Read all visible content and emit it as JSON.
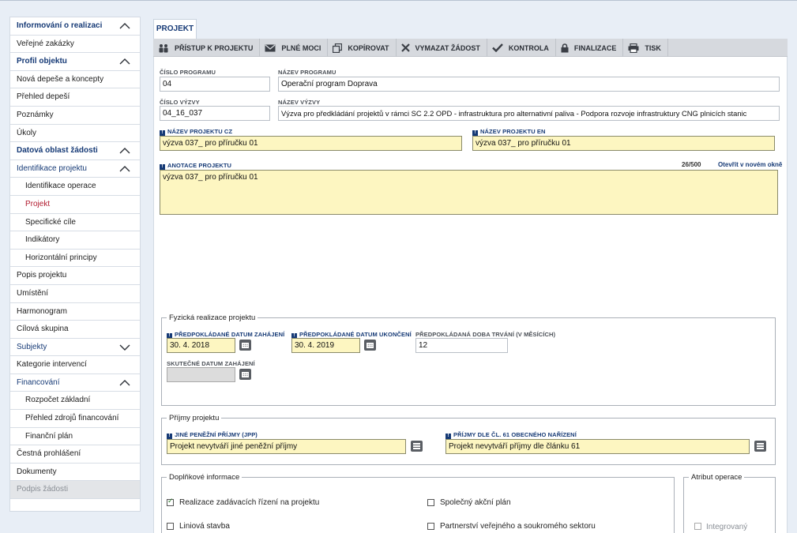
{
  "sidebar": {
    "items": [
      {
        "label": "Informování o realizaci",
        "kind": "section",
        "chevron": "up"
      },
      {
        "label": "Veřejné zakázky",
        "kind": "item"
      },
      {
        "label": "Profil objektu",
        "kind": "section",
        "chevron": "up"
      },
      {
        "label": "Nová depeše a koncepty",
        "kind": "item"
      },
      {
        "label": "Přehled depeší",
        "kind": "item"
      },
      {
        "label": "Poznámky",
        "kind": "item"
      },
      {
        "label": "Úkoly",
        "kind": "item"
      },
      {
        "label": "Datová oblast žádosti",
        "kind": "section",
        "chevron": "up"
      },
      {
        "label": "Identifikace projektu",
        "kind": "section-light",
        "chevron": "up"
      },
      {
        "label": "Identifikace operace",
        "kind": "sub"
      },
      {
        "label": "Projekt",
        "kind": "sub-active"
      },
      {
        "label": "Specifické cíle",
        "kind": "sub"
      },
      {
        "label": "Indikátory",
        "kind": "sub"
      },
      {
        "label": "Horizontální principy",
        "kind": "sub"
      },
      {
        "label": "Popis projektu",
        "kind": "item"
      },
      {
        "label": "Umístění",
        "kind": "item"
      },
      {
        "label": "Harmonogram",
        "kind": "item"
      },
      {
        "label": "Cílová skupina",
        "kind": "item"
      },
      {
        "label": "Subjekty",
        "kind": "section-light",
        "chevron": "down"
      },
      {
        "label": "Kategorie intervencí",
        "kind": "item"
      },
      {
        "label": "Financování",
        "kind": "section-light",
        "chevron": "up"
      },
      {
        "label": "Rozpočet základní",
        "kind": "sub"
      },
      {
        "label": "Přehled zdrojů financování",
        "kind": "sub"
      },
      {
        "label": "Finanční plán",
        "kind": "sub"
      },
      {
        "label": "Čestná prohlášení",
        "kind": "item"
      },
      {
        "label": "Dokumenty",
        "kind": "item"
      },
      {
        "label": "Podpis žádosti",
        "kind": "disabled"
      }
    ]
  },
  "tab": {
    "label": "PROJEKT"
  },
  "toolbar": {
    "access": "PŘÍSTUP K PROJEKTU",
    "powers": "PLNÉ MOCI",
    "copy": "KOPÍROVAT",
    "delete": "VYMAZAT ŽÁDOST",
    "check": "KONTROLA",
    "finalize": "FINALIZACE",
    "print": "TISK"
  },
  "form": {
    "program_number_label": "ČÍSLO PROGRAMU",
    "program_number": "04",
    "program_name_label": "NÁZEV PROGRAMU",
    "program_name": "Operační program Doprava",
    "call_number_label": "ČÍSLO VÝZVY",
    "call_number": "04_16_037",
    "call_name_label": "NÁZEV VÝZVY",
    "call_name": "Výzva pro předkládání projektů v rámci SC 2.2 OPD - infrastruktura pro alternativní paliva - Podpora rozvoje infrastruktury CNG plnicích stanic",
    "project_name_cz_label": "NÁZEV PROJEKTU CZ",
    "project_name_cz": "výzva 037_ pro příručku 01",
    "project_name_en_label": "NÁZEV PROJEKTU EN",
    "project_name_en": "výzva 037_ pro příručku 01",
    "annotation_label": "ANOTACE PROJEKTU",
    "annotation_counter": "26/500",
    "annotation_open_link": "Otevřít v novém okně",
    "annotation": "výzva 037_ pro příručku 01"
  },
  "physical": {
    "legend": "Fyzická realizace projektu",
    "start_label": "PŘEDPOKLÁDANÉ DATUM ZAHÁJENÍ",
    "start": "30. 4. 2018",
    "end_label": "PŘEDPOKLÁDANÉ DATUM UKONČENÍ",
    "end": "30. 4. 2019",
    "duration_label": "PŘEDPOKLÁDANÁ DOBA TRVÁNÍ (V MĚSÍCÍCH)",
    "duration": "12",
    "actual_start_label": "SKUTEČNÉ DATUM ZAHÁJENÍ",
    "actual_start": ""
  },
  "income": {
    "legend": "Příjmy projektu",
    "other_label": "JINÉ PENĚŽNÍ PŘÍJMY (JPP)",
    "other": "Projekt nevytváří jiné peněžní příjmy",
    "art61_label": "PŘÍJMY DLE ČL. 61 OBECNÉHO NAŘÍZENÍ",
    "art61": "Projekt nevytváří příjmy dle článku 61"
  },
  "additional": {
    "legend": "Doplňkové informace",
    "procurement": "Realizace zadávacích řízení na projektu",
    "joint_plan": "Společný akční plán",
    "linear": "Liniová stavba",
    "ppp": "Partnerství veřejného a soukromého sektoru"
  },
  "operation_attr": {
    "legend": "Atribut operace",
    "integrated": "Integrovaný"
  }
}
